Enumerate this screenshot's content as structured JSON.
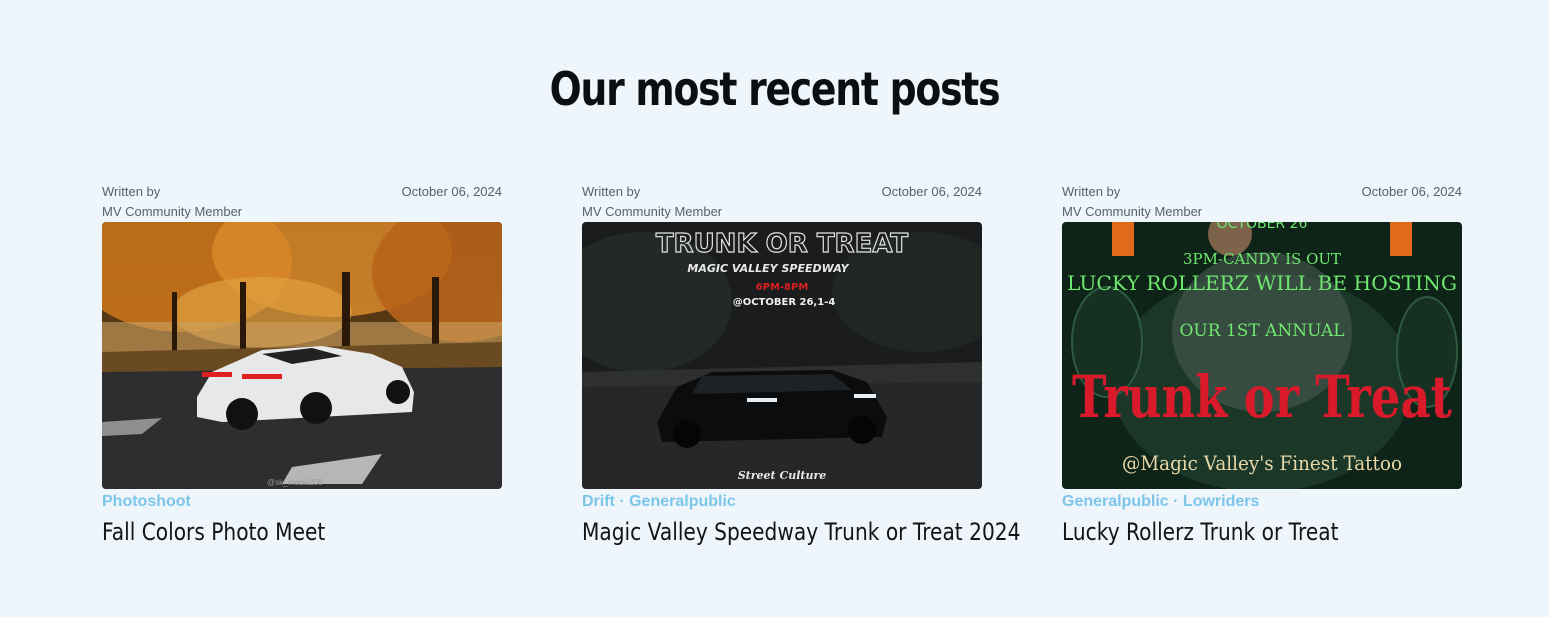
{
  "section": {
    "title": "Our most recent posts"
  },
  "posts": [
    {
      "written_by": "Written by",
      "author": "MV Community Member",
      "date": "October 06, 2024",
      "tags": "Photoshoot",
      "title": "Fall Colors Photo Meet",
      "image": {
        "watermark": "@sk_media208"
      }
    },
    {
      "written_by": "Written by",
      "author": "MV Community Member",
      "date": "October 06, 2024",
      "tags": "Drift · Generalpublic",
      "title": "Magic Valley Speedway Trunk or Treat 2024",
      "image": {
        "headline": "TRUNK OR TREAT",
        "venue": "MAGIC VALLEY SPEEDWAY",
        "time": "6PM-8PM",
        "date": "@OCTOBER 26,1-4",
        "footer": "Street Culture"
      }
    },
    {
      "written_by": "Written by",
      "author": "MV Community Member",
      "date": "October 06, 2024",
      "tags": "Generalpublic · Lowriders",
      "title": "Lucky Rollerz Trunk or Treat",
      "image": {
        "top": "OCTOBER 26",
        "line1": "3PM-CANDY IS OUT",
        "line2": "LUCKY ROLLERZ WILL BE HOSTING",
        "line3": "OUR 1ST ANNUAL",
        "headline": "Trunk or Treat",
        "line4": "@Magic Valley's Finest Tattoo"
      }
    }
  ]
}
